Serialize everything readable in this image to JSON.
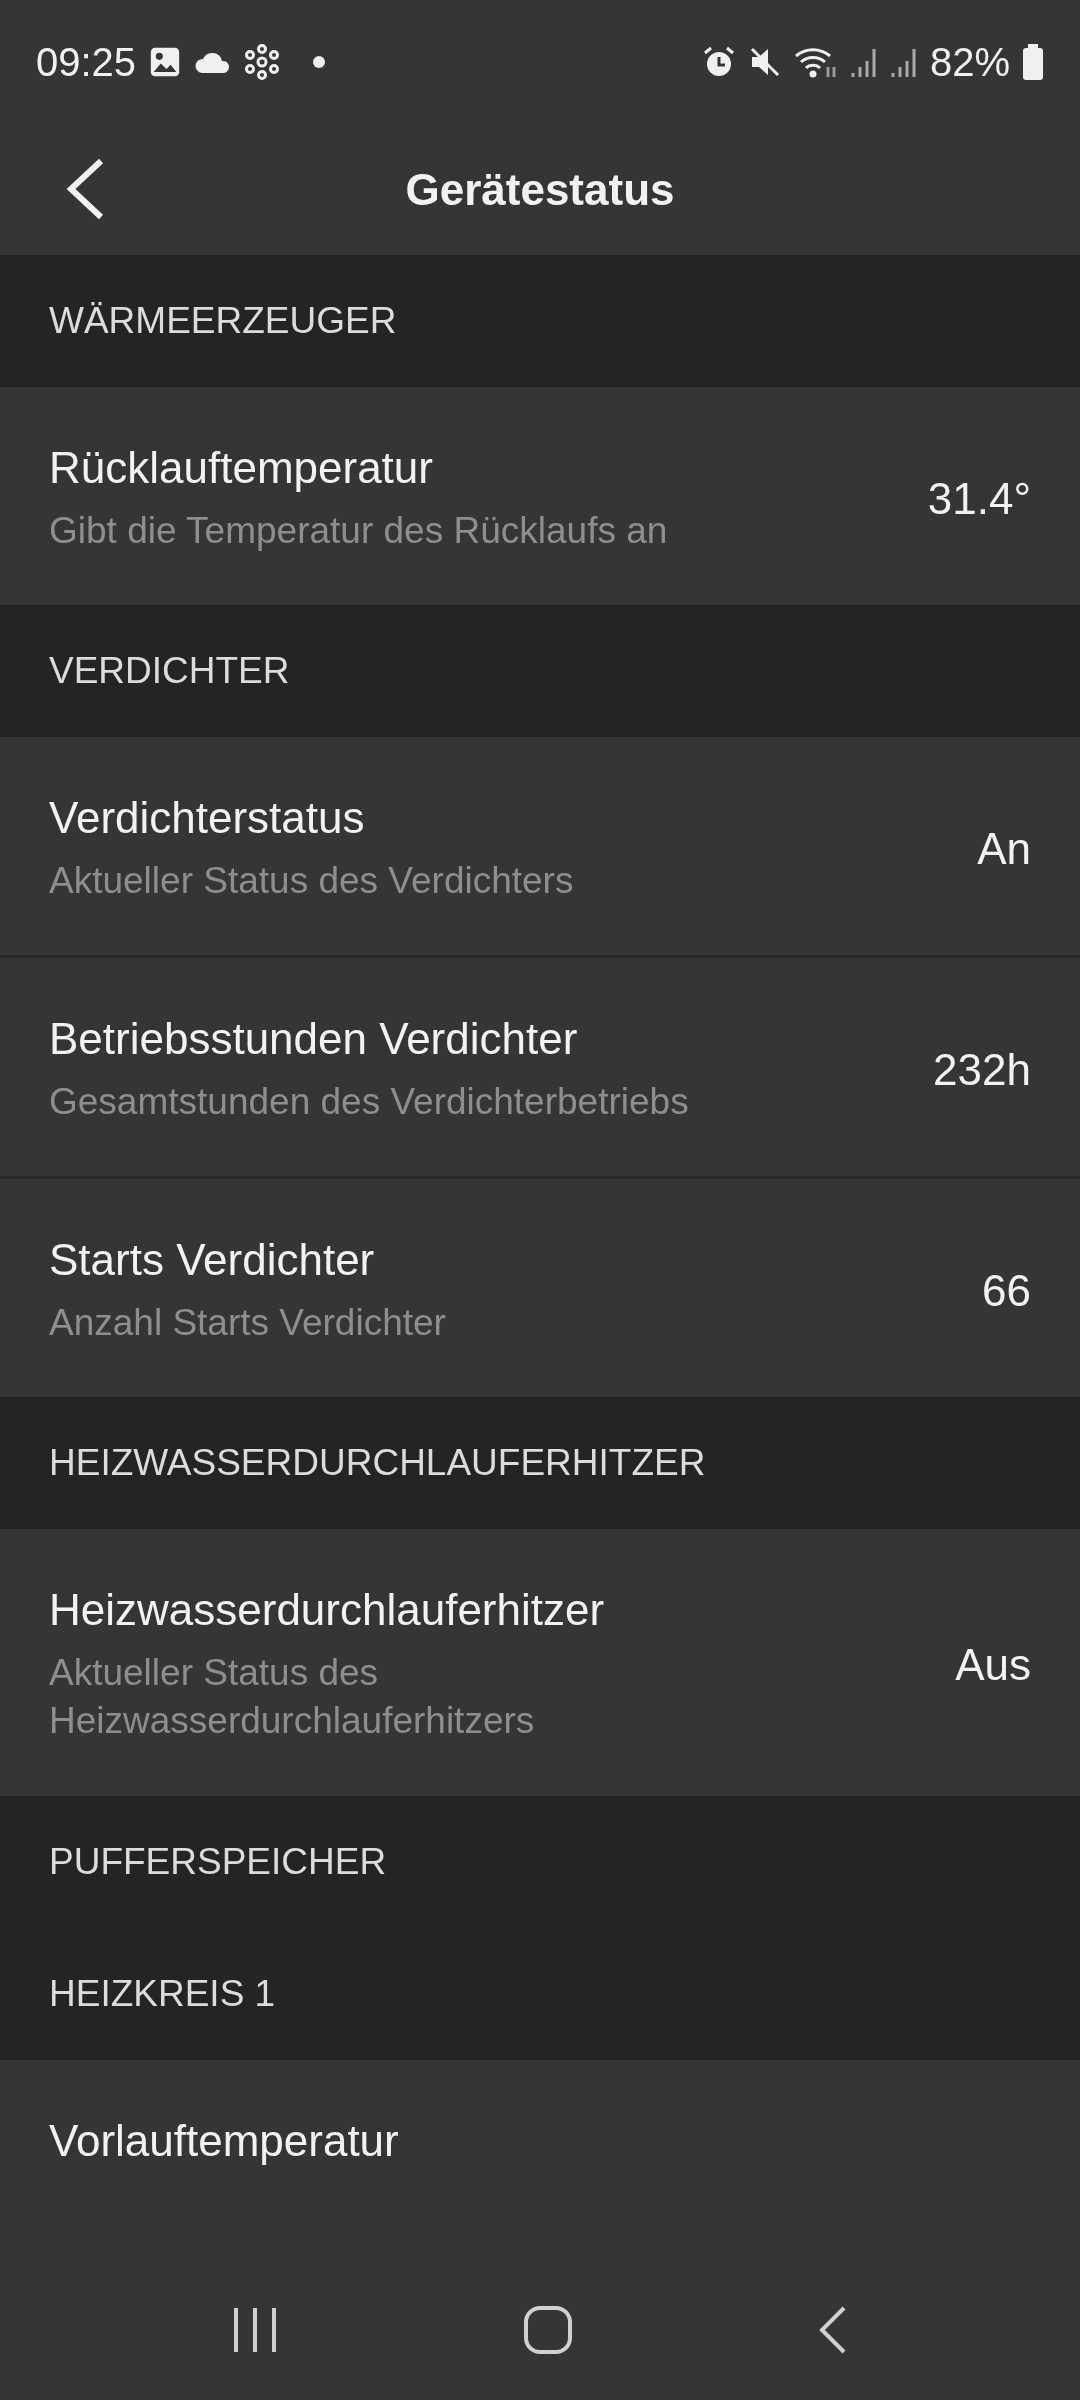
{
  "status_bar": {
    "time": "09:25",
    "battery": "82%"
  },
  "header": {
    "title": "Gerätestatus"
  },
  "sections": [
    {
      "title": "WÄRMEERZEUGER",
      "items": [
        {
          "title": "Rücklauftemperatur",
          "description": "Gibt die Temperatur des Rücklaufs an",
          "value": "31.4°"
        }
      ]
    },
    {
      "title": "VERDICHTER",
      "items": [
        {
          "title": "Verdichterstatus",
          "description": "Aktueller Status des Verdichters",
          "value": "An"
        },
        {
          "title": "Betriebsstunden Verdichter",
          "description": "Gesamtstunden des Verdichterbetriebs",
          "value": "232h"
        },
        {
          "title": "Starts Verdichter",
          "description": "Anzahl Starts Verdichter",
          "value": "66"
        }
      ]
    },
    {
      "title": "HEIZWASSERDURCHLAUFERHITZER",
      "items": [
        {
          "title": "Heizwasserdurchlauferhitzer",
          "description": "Aktueller Status des Heizwasserdurchlauferhitzers",
          "value": "Aus"
        }
      ]
    },
    {
      "title": "PUFFERSPEICHER"
    },
    {
      "title": "HEIZKREIS 1",
      "items": [
        {
          "title": "Vorlauftemperatur"
        }
      ]
    }
  ]
}
